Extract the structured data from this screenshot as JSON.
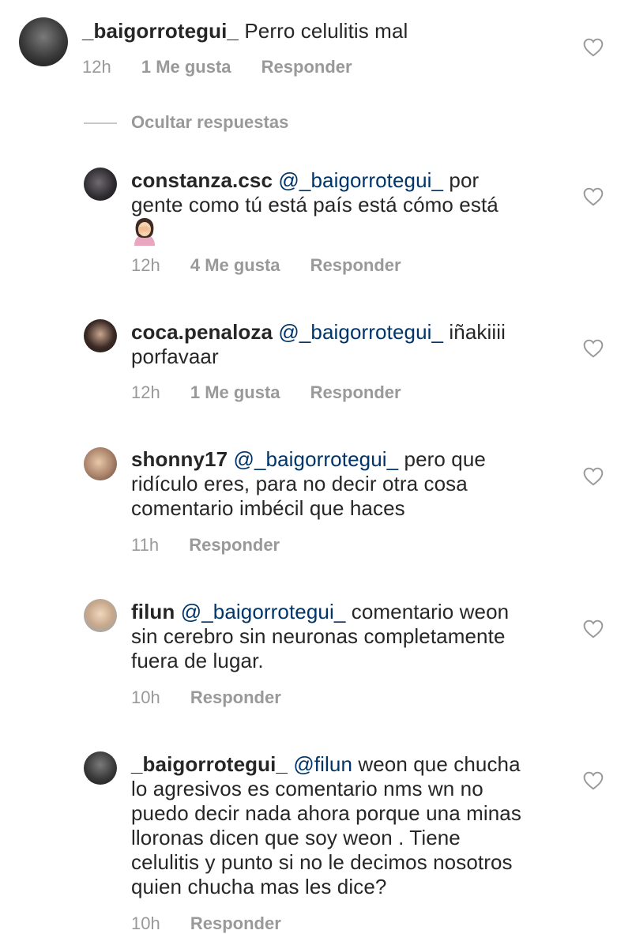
{
  "top_comment": {
    "username": "_baigorrotegui_",
    "text": "Perro celulitis mal",
    "time": "12h",
    "likes": "1 Me gusta",
    "reply_label": "Responder"
  },
  "hide_replies_label": "Ocultar respuestas",
  "replies": [
    {
      "username": "constanza.csc",
      "mention": "@_baigorrotegui_",
      "line1": " por",
      "line2": "gente como tú está país está cómo está",
      "emoji": "woman-facepalming-emoji",
      "time": "12h",
      "likes": "4 Me gusta",
      "reply_label": "Responder"
    },
    {
      "username": "coca.penaloza",
      "mention": "@_baigorrotegui_",
      "line1": " iñakiiii",
      "line2": "porfavaar",
      "time": "12h",
      "likes": "1 Me gusta",
      "reply_label": "Responder"
    },
    {
      "username": "shonny17",
      "mention": "@_baigorrotegui_",
      "line1": " pero que",
      "line2": "ridículo eres, para no decir otra cosa",
      "line3": "comentario imbécil que haces",
      "time": "11h",
      "reply_label": "Responder"
    },
    {
      "username": "filun",
      "mention": "@_baigorrotegui_",
      "line1": " comentario weon",
      "line2": "sin cerebro sin neuronas completamente",
      "line3": "fuera de lugar.",
      "time": "10h",
      "reply_label": "Responder"
    },
    {
      "username": "_baigorrotegui_",
      "mention": "@filun",
      "line1": " weon que chucha",
      "line2": "lo agresivos es comentario nms wn no",
      "line3": "puedo decir nada ahora porque una minas",
      "line4": "lloronas dicen que soy weon . Tiene",
      "line5": "celulitis y punto si no le decimos nosotros",
      "line6": "quien chucha mas les dice?",
      "time": "10h",
      "reply_label": "Responder"
    }
  ]
}
